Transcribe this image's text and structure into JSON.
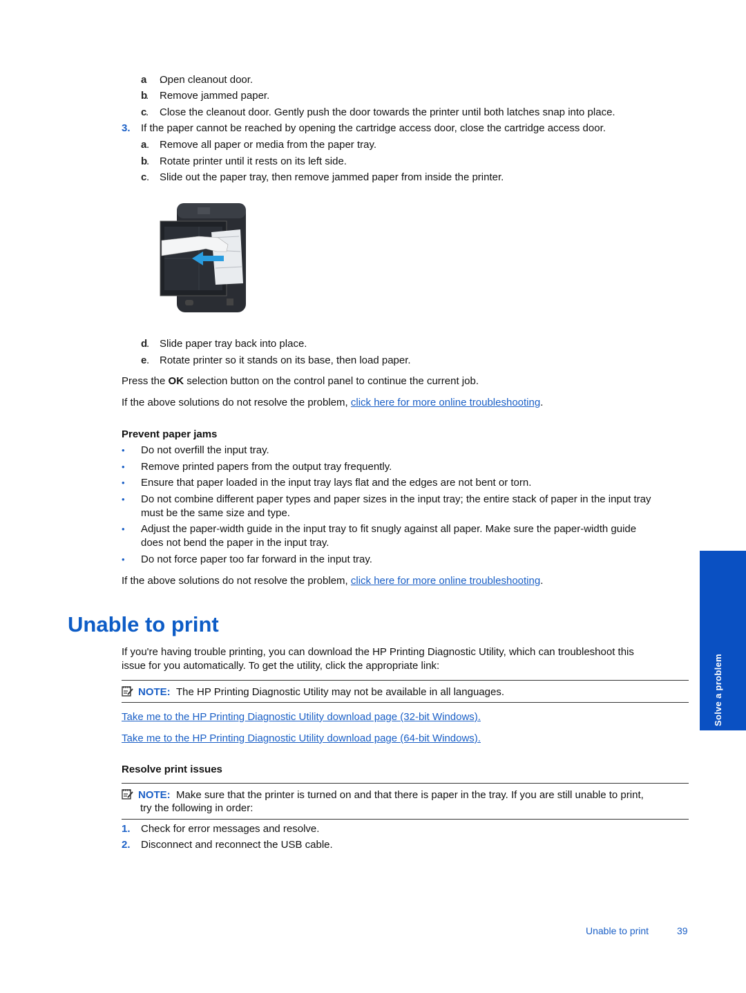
{
  "steps_continued": [
    {
      "label": "a",
      "text": "Open cleanout door."
    },
    {
      "label": "b",
      "text": "Remove jammed paper."
    },
    {
      "label": "c",
      "text": "Close the cleanout door. Gently push the door towards the printer until both latches snap into place."
    }
  ],
  "step3": {
    "number": "3.",
    "text": "If the paper cannot be reached by opening the cartridge access door, close the cartridge access door.",
    "substeps": [
      {
        "label": "a",
        "text": "Remove all paper or media from the paper tray."
      },
      {
        "label": "b",
        "text": "Rotate printer until it rests on its left side."
      },
      {
        "label": "c",
        "text": "Slide out the paper tray, then remove jammed paper from inside the printer."
      }
    ],
    "substeps_after": [
      {
        "label": "d",
        "text": "Slide paper tray back into place."
      },
      {
        "label": "e",
        "text": "Rotate printer so it stands on its base, then load paper."
      }
    ]
  },
  "illustration": {
    "icon": "printer-paper-jam-illustration",
    "arrow_color": "#2a9de0"
  },
  "press_ok": {
    "before": "Press the ",
    "bold": "OK",
    "after": " selection button on the control panel to continue the current job."
  },
  "troubleshoot1": {
    "before": "If the above solutions do not resolve the problem, ",
    "link": "click here for more online troubleshooting",
    "after": "."
  },
  "prevent": {
    "heading": "Prevent paper jams",
    "bullet": "•",
    "items": [
      {
        "lines": [
          "Do not overfill the input tray."
        ]
      },
      {
        "lines": [
          "Remove printed papers from the output tray frequently."
        ]
      },
      {
        "lines": [
          "Ensure that paper loaded in the input tray lays flat and the edges are not bent or torn."
        ]
      },
      {
        "lines": [
          "Do not combine different paper types and paper sizes in the input tray; the entire stack of paper in the input tray",
          "must be the same size and type."
        ]
      },
      {
        "lines": [
          "Adjust the paper-width guide in the input tray to fit snugly against all paper. Make sure the paper-width guide",
          "does not bend the paper in the input tray."
        ]
      },
      {
        "lines": [
          "Do not force paper too far forward in the input tray."
        ]
      }
    ]
  },
  "troubleshoot2": {
    "before": "If the above solutions do not resolve the problem, ",
    "link": "click here for more online troubleshooting",
    "after": "."
  },
  "section": {
    "title": "Unable to print",
    "intro_lines": [
      "If you're having trouble printing, you can download the HP Printing Diagnostic Utility, which can troubleshoot this",
      "issue for you automatically. To get the utility, click the appropriate link:"
    ],
    "note1": {
      "label": "NOTE:",
      "text": "The HP Printing Diagnostic Utility may not be available in all languages."
    },
    "link32": "Take me to the HP Printing Diagnostic Utility download page (32-bit Windows).",
    "link64": "Take me to the HP Printing Diagnostic Utility download page (64-bit Windows).",
    "resolve_heading": "Resolve print issues",
    "note2": {
      "label": "NOTE:",
      "line1": "Make sure that the printer is turned on and that there is paper in the tray. If you are still unable to print,",
      "line2": "try the following in order:"
    },
    "steps": [
      {
        "number": "1.",
        "text": "Check for error messages and resolve."
      },
      {
        "number": "2.",
        "text": "Disconnect and reconnect the USB cable."
      }
    ]
  },
  "side_tab": {
    "label": "Solve a problem",
    "color": "#0a50c2"
  },
  "footer": {
    "section": "Unable to print",
    "page": "39"
  },
  "colors": {
    "accent": "#1a5fc6",
    "heading": "#0d5cc6"
  }
}
